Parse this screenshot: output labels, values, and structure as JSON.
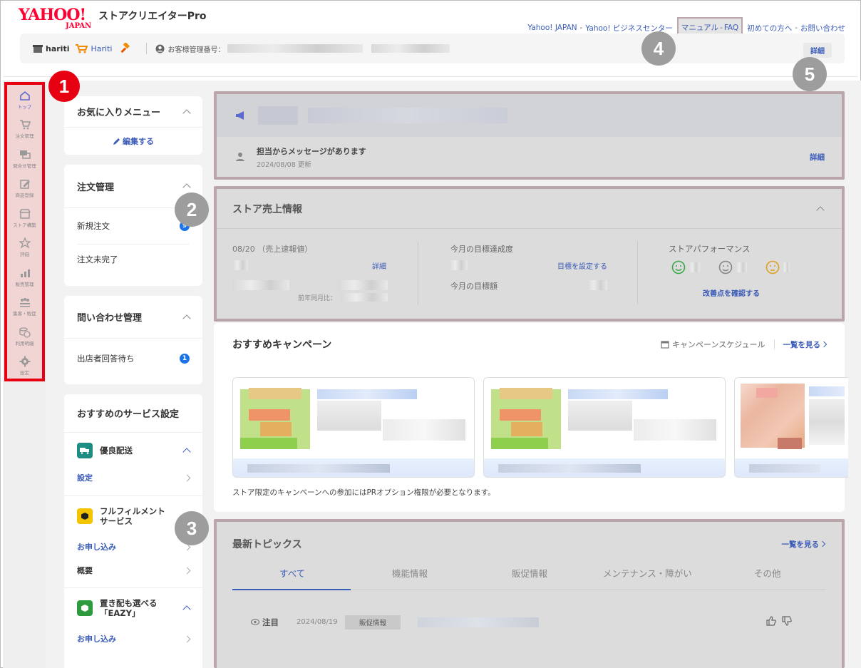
{
  "header": {
    "logo_main": "YAHOO!",
    "logo_sub": "JAPAN",
    "app_name": "ストアクリエイターPro",
    "links": [
      "Yahoo! JAPAN",
      "Yahoo! ビジネスセンター",
      "マニュアル",
      "FAQ",
      "初めての方へ",
      "お問い合わせ"
    ],
    "store_id": "hariti",
    "store_name": "Hariti",
    "customer_number_label": "お客様管理番号：",
    "detail_label": "詳細"
  },
  "badges": [
    "1",
    "2",
    "3",
    "4",
    "5"
  ],
  "rail": {
    "items": [
      {
        "label": "トップ",
        "icon": "home-icon"
      },
      {
        "label": "注文管理",
        "icon": "cart-icon"
      },
      {
        "label": "問合せ管理",
        "icon": "chat-icon"
      },
      {
        "label": "商品登録",
        "icon": "edit-icon"
      },
      {
        "label": "ストア構築",
        "icon": "store-icon"
      },
      {
        "label": "評価",
        "icon": "star-icon"
      },
      {
        "label": "販売管理",
        "icon": "bar-chart-icon"
      },
      {
        "label": "集客・販促",
        "icon": "people-icon"
      },
      {
        "label": "利用明細",
        "icon": "coins-icon"
      },
      {
        "label": "設定",
        "icon": "gear-icon"
      }
    ]
  },
  "favorites": {
    "title": "お気に入りメニュー",
    "edit_label": "編集する"
  },
  "orders": {
    "title": "注文管理",
    "rows": [
      {
        "label": "新規注文",
        "count": "9"
      },
      {
        "label": "注文未完了",
        "count": ""
      }
    ]
  },
  "inquiries": {
    "title": "問い合わせ管理",
    "rows": [
      {
        "label": "出店者回答待ち",
        "count": "1"
      }
    ]
  },
  "services": {
    "title": "おすすめのサービス設定",
    "items": [
      {
        "name": "優良配送",
        "links": [
          "設定"
        ]
      },
      {
        "name_line1": "フルフィルメント",
        "name_line2": "サービス",
        "links": [
          "お申し込み",
          "概要"
        ]
      },
      {
        "name_line1": "置き配も選べる",
        "name_line2": "「EAZY」",
        "links": [
          "お申し込み"
        ]
      }
    ]
  },
  "notice": {
    "message": "担当からメッセージがあります",
    "updated": "2024/08/08 更新",
    "detail_label": "詳細"
  },
  "sales": {
    "title": "ストア売上情報",
    "date_label": "08/20 （売上速報値）",
    "detail_label": "詳細",
    "yoy_label": "前年同月比：",
    "target_title": "今月の目標達成度",
    "set_target_label": "目標を設定する",
    "target_amount_label": "今月の目標額",
    "performance_title": "ストアパフォーマンス",
    "improve_label": "改善点を確認する"
  },
  "campaign": {
    "title": "おすすめキャンペーン",
    "schedule_label": "キャンペーンスケジュール",
    "see_all_label": "一覧を見る",
    "note": "ストア限定のキャンペーンへの参加にはPRオプション権限が必要となります。"
  },
  "topics": {
    "title": "最新トピックス",
    "see_all_label": "一覧を見る",
    "tabs": [
      "すべて",
      "機能情報",
      "販促情報",
      "メンテナンス・障がい",
      "その他"
    ],
    "item": {
      "tag": "注目",
      "date": "2024/08/19",
      "category": "販促情報"
    }
  },
  "colors": {
    "accent": "#3a5bb8",
    "brand": "#ff0033",
    "annotation_red": "#e60012",
    "annotation_gray": "#9d9d9d"
  }
}
